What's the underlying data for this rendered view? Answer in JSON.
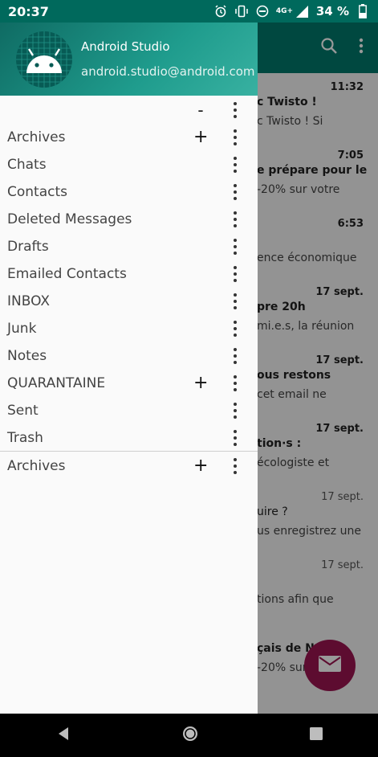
{
  "status_bar": {
    "time": "20:37",
    "network": "4G+",
    "battery_percent": "34 %",
    "icons": [
      "alarm-icon",
      "vibrate-icon",
      "dnd-icon",
      "network-4g-icon",
      "signal-icon",
      "battery-icon"
    ]
  },
  "background_app": {
    "toolbar_icons": [
      "search-icon",
      "overflow-menu-icon"
    ],
    "messages": [
      {
        "date": "11:32",
        "subject": "c Twisto !",
        "preview": "c Twisto ! Si",
        "unread": true
      },
      {
        "date": "7:05",
        "subject": "e prépare pour le",
        "preview": "-20% sur votre",
        "unread": true
      },
      {
        "date": "6:53",
        "subject": "",
        "preview": "ence économique",
        "unread": true
      },
      {
        "date": "17 sept.",
        "subject": "pre 20h",
        "preview": "mi.e.s, la réunion",
        "unread": true
      },
      {
        "date": "17 sept.",
        "subject": "ous restons",
        "preview": "cet email ne",
        "unread": true
      },
      {
        "date": "17 sept.",
        "subject": "tion·s :",
        "preview": "écologiste et",
        "unread": true
      },
      {
        "date": "17 sept.",
        "subject": "uire ?",
        "preview": "us enregistrez une",
        "unread": false
      },
      {
        "date": "17 sept.",
        "subject": "",
        "preview": "tions afin que",
        "unread": false
      },
      {
        "date": "",
        "subject": "çais de N",
        "preview": "-20% sur votre",
        "unread": true
      }
    ],
    "fab_icon": "mail-icon",
    "fab_color": "#9c1550"
  },
  "drawer": {
    "account_name": "Android Studio",
    "account_email": "android.studio@android.com",
    "header_color": "#1f9c8d",
    "top_row_action": "-",
    "folders": [
      {
        "label": "Archives",
        "action": "+"
      },
      {
        "label": "Chats",
        "action": ""
      },
      {
        "label": "Contacts",
        "action": ""
      },
      {
        "label": "Deleted Messages",
        "action": ""
      },
      {
        "label": "Drafts",
        "action": ""
      },
      {
        "label": "Emailed Contacts",
        "action": ""
      },
      {
        "label": "INBOX",
        "action": ""
      },
      {
        "label": "Junk",
        "action": ""
      },
      {
        "label": "Notes",
        "action": ""
      },
      {
        "label": "QUARANTAINE",
        "action": "+"
      },
      {
        "label": "Sent",
        "action": ""
      },
      {
        "label": "Trash",
        "action": ""
      }
    ],
    "second_account_folders": [
      {
        "label": "Archives",
        "action": "+"
      }
    ]
  },
  "nav_bar": {
    "buttons": [
      "back-icon",
      "home-icon",
      "recents-icon"
    ]
  }
}
